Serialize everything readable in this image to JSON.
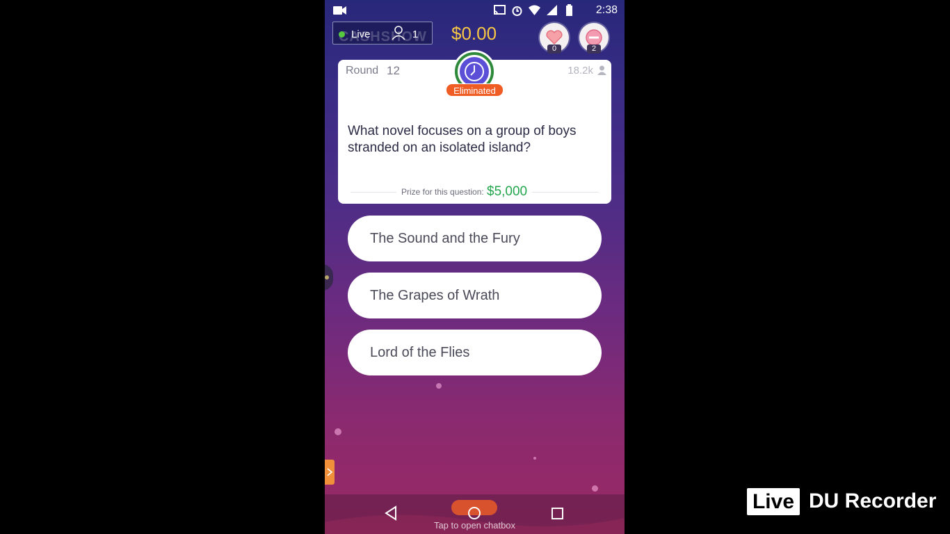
{
  "status_bar": {
    "time": "2:38",
    "icons": [
      "video-camera-icon",
      "cast-icon",
      "alarm-icon",
      "wifi-icon",
      "signal-icon",
      "battery-icon"
    ]
  },
  "header": {
    "watermark": "CASHSHOW",
    "live_label": "Live",
    "viewer_count": "1",
    "balance": "$0.00",
    "hearts_count": "0",
    "erasers_count": "2"
  },
  "question_card": {
    "round_label": "Round",
    "round_number": "12",
    "players_count": "18.2k",
    "status_badge": "Eliminated",
    "question": "What novel focuses on a group of boys stranded on an isolated island?",
    "prize_label": "Prize for this question:",
    "prize_value": "$5,000"
  },
  "answers": [
    {
      "label": "The Sound and the Fury"
    },
    {
      "label": "The Grapes of Wrath"
    },
    {
      "label": "Lord of the Flies"
    }
  ],
  "nav_bar": {
    "chat_hint": "Tap to open chatbox"
  },
  "recorder_overlay": {
    "live_tag": "Live",
    "app_name": "DU Recorder"
  },
  "colors": {
    "balance": "#f6c644",
    "prize": "#22a64c",
    "eliminated_badge": "#ef5c24",
    "live_dot": "#56c93f",
    "timer_ring": "#2e8a3a",
    "timer_face": "#5a4fd6"
  }
}
